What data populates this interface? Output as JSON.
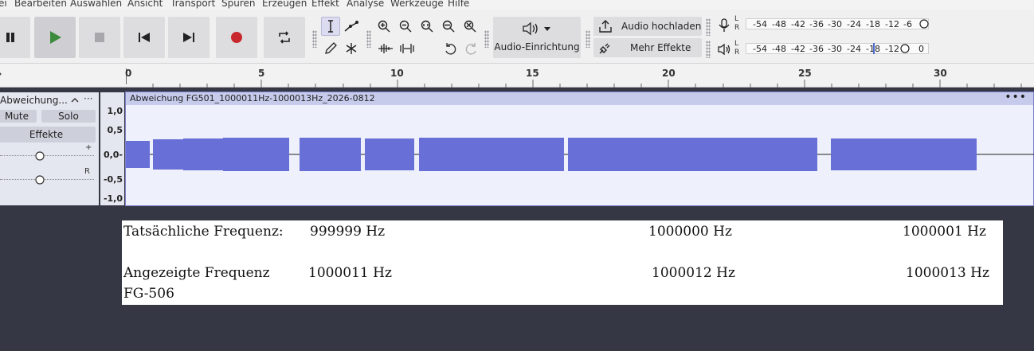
{
  "menu": [
    "ei",
    "Bearbeiten",
    "Auswählen",
    "Ansicht",
    "Transport",
    "Spuren",
    "Erzeugen",
    "Effekt",
    "Analyse",
    "Werkzeuge",
    "Hilfe"
  ],
  "toolbar": {
    "audio_setup_label": "Audio-Einrichtung",
    "share_audio_label": "Audio hochladen",
    "more_effects_label": "Mehr Effekte"
  },
  "meters": {
    "record_channels": [
      "L",
      "R"
    ],
    "play_channels": [
      "L",
      "R"
    ],
    "record_ticks": [
      "-54",
      "-48",
      "-42",
      "-36",
      "-30",
      "-24",
      "-18",
      "-12",
      "-6"
    ],
    "play_ticks": [
      "-54",
      "-48",
      "-42",
      "-36",
      "-30",
      "-24",
      "-18",
      "-12",
      "0"
    ]
  },
  "ruler": {
    "labels": [
      "0",
      "5",
      "10",
      "15",
      "20",
      "25",
      "30"
    ]
  },
  "track": {
    "name": "Abweichung...",
    "mute_label": "Mute",
    "solo_label": "Solo",
    "effects_label": "Effekte",
    "pan_right_label": "R",
    "gain_plus_label": "+"
  },
  "vertical_scale": [
    "1,0",
    "0,5",
    "0,0-",
    "-0,5",
    "-1,0"
  ],
  "clip": {
    "name": "Abweichung FG501_1000011Hz-1000013Hz_2026-0812",
    "menu_glyph": "•••"
  },
  "info": {
    "actual_label": "Tatsächliche Frequenz:",
    "actual_values": [
      "999999 Hz",
      "1000000 Hz",
      "1000001 Hz"
    ],
    "displayed_label": "Angezeigte Frequenz",
    "displayed_sublabel": "FG-506",
    "displayed_values": [
      "1000011 Hz",
      "1000012 Hz",
      "1000013 Hz"
    ]
  },
  "colors": {
    "waveform": "#6870d8",
    "background": "#363744",
    "record": "#c8282d",
    "play": "#3d8b3d"
  }
}
